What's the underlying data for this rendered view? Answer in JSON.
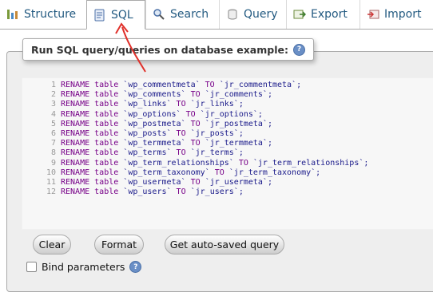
{
  "tabs": [
    {
      "label": "Structure",
      "icon": "structure-icon"
    },
    {
      "label": "SQL",
      "icon": "sql-icon",
      "active": true
    },
    {
      "label": "Search",
      "icon": "search-icon"
    },
    {
      "label": "Query",
      "icon": "query-icon"
    },
    {
      "label": "Export",
      "icon": "export-icon"
    },
    {
      "label": "Import",
      "icon": "import-icon"
    }
  ],
  "sql_panel": {
    "legend": "Run SQL query/queries on database example:",
    "help_glyph": "?",
    "lines": [
      {
        "n": "1",
        "from": "`wp_commentmeta`",
        "to": "`jr_commentmeta`;"
      },
      {
        "n": "2",
        "from": "`wp_comments`",
        "to": "`jr_comments`;"
      },
      {
        "n": "3",
        "from": "`wp_links`",
        "to": "`jr_links`;"
      },
      {
        "n": "4",
        "from": "`wp_options`",
        "to": "`jr_options`;"
      },
      {
        "n": "5",
        "from": "`wp_postmeta`",
        "to": "`jr_postmeta`;"
      },
      {
        "n": "6",
        "from": "`wp_posts`",
        "to": "`jr_posts`;"
      },
      {
        "n": "7",
        "from": "`wp_termmeta`",
        "to": "`jr_termmeta`;"
      },
      {
        "n": "8",
        "from": "`wp_terms`",
        "to": "`jr_terms`;"
      },
      {
        "n": "9",
        "from": "`wp_term_relationships`",
        "to": "`jr_term_relationships`;"
      },
      {
        "n": "10",
        "from": "`wp_term_taxonomy`",
        "to": "`jr_term_taxonomy`;"
      },
      {
        "n": "11",
        "from": "`wp_usermeta`",
        "to": "`jr_usermeta`;"
      },
      {
        "n": "12",
        "from": "`wp_users`",
        "to": "`jr_users`;"
      }
    ],
    "kw_rename": "RENAME",
    "kw_table": "table",
    "kw_to": "TO"
  },
  "buttons": {
    "clear": "Clear",
    "format": "Format",
    "autosaved": "Get auto-saved query"
  },
  "bind_parameters": {
    "label": "Bind parameters",
    "checked": false
  },
  "colors": {
    "link": "#235a81",
    "annotation_arrow": "#e0302a"
  }
}
